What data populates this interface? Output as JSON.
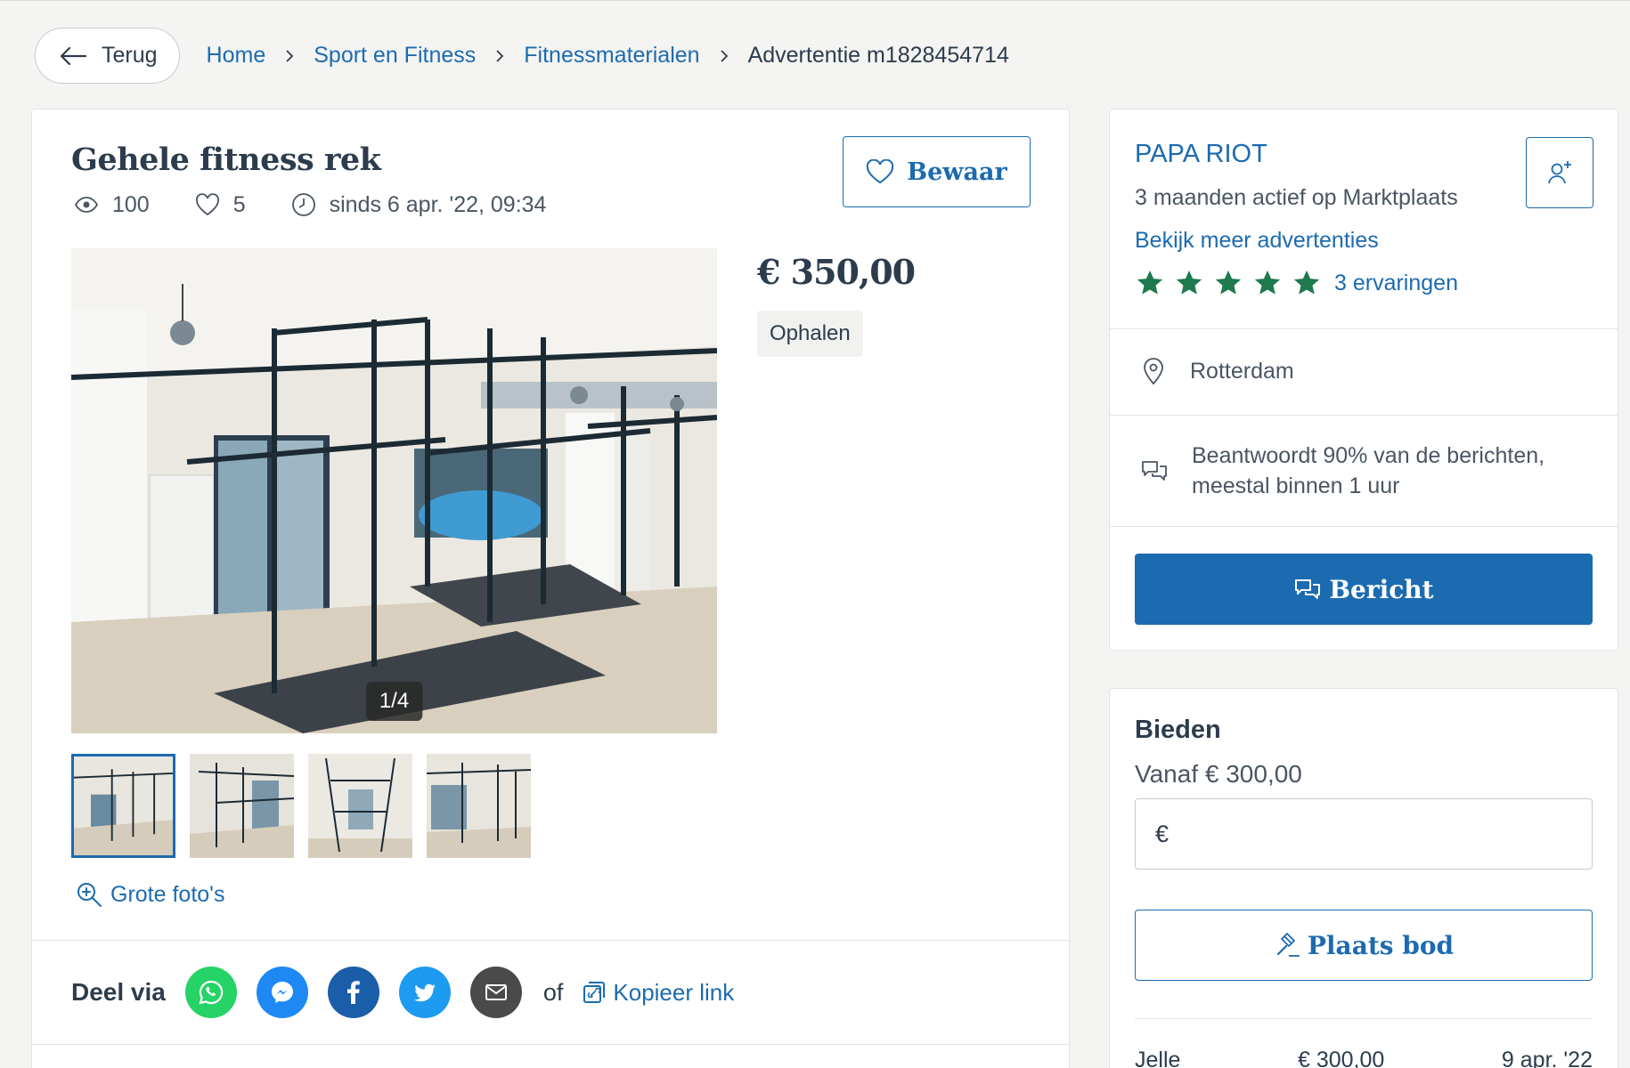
{
  "breadcrumb": {
    "back_label": "Terug",
    "items": [
      "Home",
      "Sport en Fitness",
      "Fitnessmaterialen"
    ],
    "current": "Advertentie m1828454714"
  },
  "listing": {
    "title": "Gehele fitness rek",
    "views": "100",
    "favorites": "5",
    "since": "sinds 6 apr. '22, 09:34",
    "save_label": "Bewaar",
    "price": "€ 350,00",
    "delivery": "Ophalen",
    "photo_counter": "1/4",
    "big_photos_label": "Grote foto's"
  },
  "share": {
    "label": "Deel via",
    "or_label": "of",
    "copy_label": "Kopieer link"
  },
  "seller": {
    "name": "PAPA RIOT",
    "active": "3 maanden actief op Marktplaats",
    "more_ads": "Bekijk meer advertenties",
    "stars": 5,
    "reviews": "3 ervaringen",
    "location": "Rotterdam",
    "response_line1": "Beantwoordt 90% van de berichten,",
    "response_line2": "meestal binnen 1 uur",
    "message_label": "Bericht"
  },
  "bidding": {
    "title": "Bieden",
    "from": "Vanaf € 300,00",
    "currency": "€",
    "bid_value": "",
    "place_bid_label": "Plaats bod",
    "bids": [
      {
        "name": "Jelle",
        "amount": "€ 300,00",
        "date": "9 apr. '22"
      }
    ]
  },
  "colors": {
    "accent": "#1c6bb0",
    "star": "#1e7a4c",
    "whatsapp": "#25d366",
    "messenger": "#1e88f5",
    "facebook": "#1a5da8",
    "twitter": "#1d9bf0",
    "email": "#4a4a4a"
  }
}
